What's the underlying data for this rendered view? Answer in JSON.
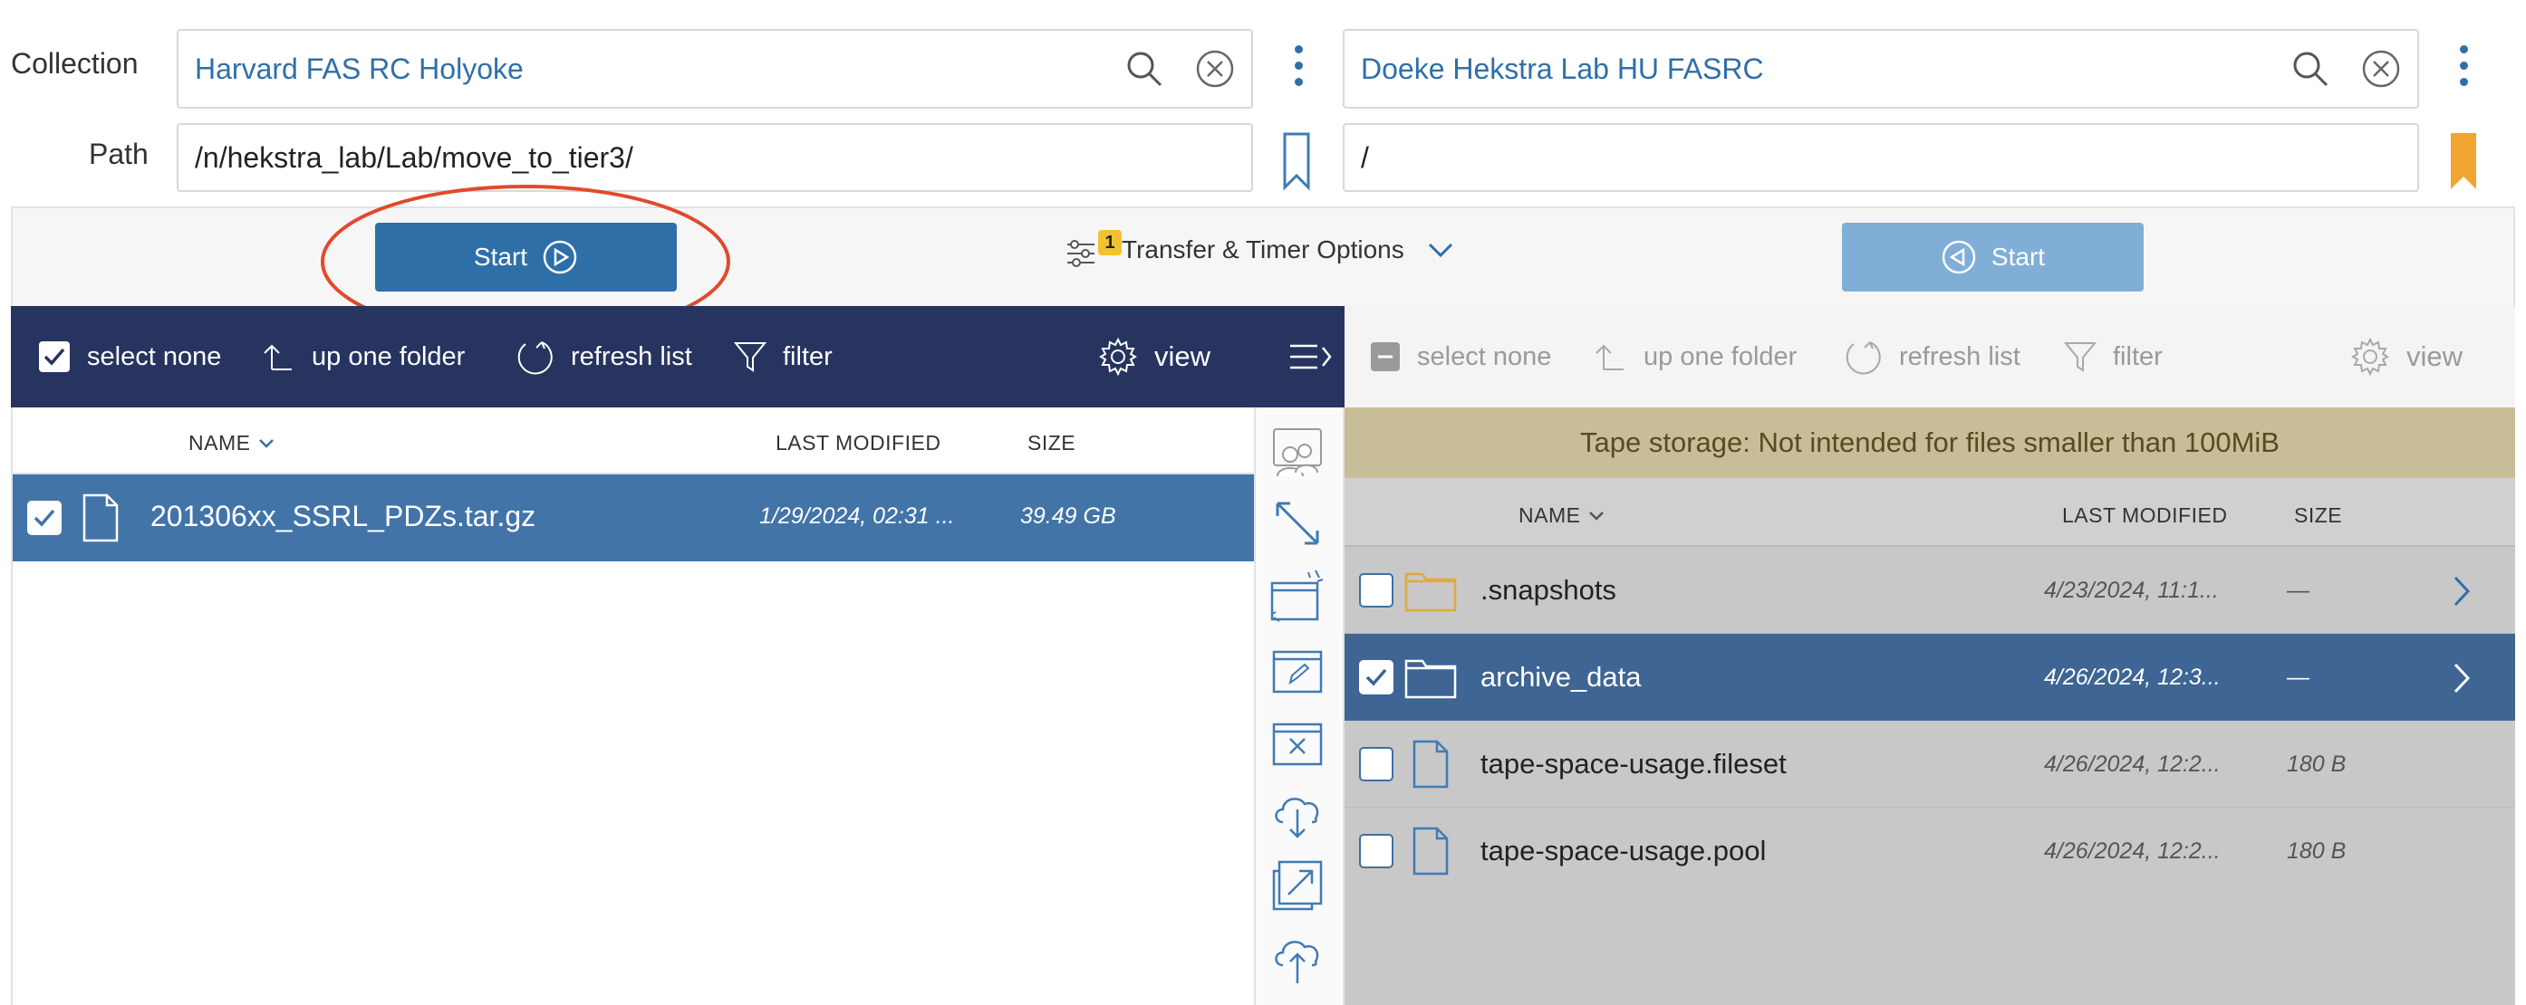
{
  "left": {
    "collection_label": "Collection",
    "collection_value": "Harvard FAS RC Holyoke",
    "path_label": "Path",
    "path_value": "/n/hekstra_lab/Lab/move_to_tier3/"
  },
  "right": {
    "collection_value": "Doeke Hekstra Lab HU FASRC",
    "path_value": "/"
  },
  "controls": {
    "start_left": "Start",
    "start_right": "Start",
    "options_label": "Transfer & Timer Options",
    "options_badge": "1"
  },
  "left_toolbar": {
    "select_none": "select none",
    "up_one_folder": "up one folder",
    "refresh_list": "refresh list",
    "filter": "filter",
    "view": "view"
  },
  "right_toolbar": {
    "select_none": "select none",
    "up_one_folder": "up one folder",
    "refresh_list": "refresh list",
    "filter": "filter",
    "view": "view"
  },
  "left_table": {
    "col_name": "NAME",
    "col_modified": "LAST MODIFIED",
    "col_size": "SIZE",
    "rows": [
      {
        "name": "201306xx_SSRL_PDZs.tar.gz",
        "modified": "1/29/2024, 02:31 ...",
        "size": "39.49 GB",
        "selected": true
      }
    ]
  },
  "right_table": {
    "banner": "Tape storage: Not intended for files smaller than 100MiB",
    "col_name": "NAME",
    "col_modified": "LAST MODIFIED",
    "col_size": "SIZE",
    "rows": [
      {
        "name": ".snapshots",
        "modified": "4/23/2024, 11:1...",
        "size": "—",
        "type": "folder",
        "selected": false
      },
      {
        "name": "archive_data",
        "modified": "4/26/2024, 12:3...",
        "size": "—",
        "type": "folder",
        "selected": true
      },
      {
        "name": "tape-space-usage.fileset",
        "modified": "4/26/2024, 12:2...",
        "size": "180 B",
        "type": "file",
        "selected": false
      },
      {
        "name": "tape-space-usage.pool",
        "modified": "4/26/2024, 12:2...",
        "size": "180 B",
        "type": "file",
        "selected": false
      }
    ]
  },
  "colors": {
    "accent": "#2f6fa8",
    "toolbar_dark": "#26345f",
    "selected_row": "#4274a8",
    "right_pane_bg": "#c8c8c8",
    "banner_bg": "#c8bd99",
    "bookmark_orange": "#f0a531",
    "annotation_red": "#e14a2b"
  }
}
